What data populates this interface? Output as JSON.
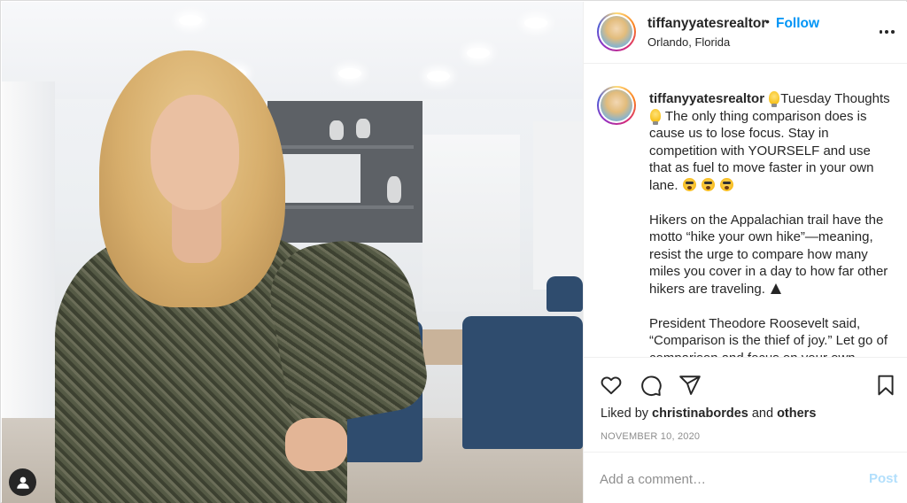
{
  "header": {
    "username": "tiffanyyatesrealtor",
    "separator": "•",
    "follow_label": "Follow",
    "location": "Orlando, Florida"
  },
  "caption": {
    "username": "tiffanyyatesrealtor",
    "paragraph1_a": "Tuesday Thoughts ",
    "paragraph1_b": " The only thing comparison does is cause us to lose focus. Stay in competition with YOURSELF and use that as fuel to move faster in your own lane. ",
    "paragraph2": "Hikers on the Appalachian trail have the motto “hike your own hike”—meaning, resist the urge to compare how many miles you cover in a day to how far other hikers are traveling. ",
    "paragraph3": "President Theodore Roosevelt said, “Comparison is the thief of joy.” Let go of comparison and focus on your own journey."
  },
  "likes": {
    "prefix": "Liked by ",
    "user": "christinabordes",
    "middle": " and ",
    "others": "others"
  },
  "date": "NOVEMBER 10, 2020",
  "comment": {
    "placeholder": "Add a comment…",
    "post_label": "Post"
  },
  "icons": {
    "like": "heart-icon",
    "comment": "comment-icon",
    "share": "share-icon",
    "save": "bookmark-icon",
    "more": "more-options-icon",
    "tag": "user-tag-icon"
  },
  "colors": {
    "follow_blue": "#0095f6",
    "post_disabled": "#b2dffc",
    "text": "#262626",
    "muted": "#8e8e8e"
  }
}
